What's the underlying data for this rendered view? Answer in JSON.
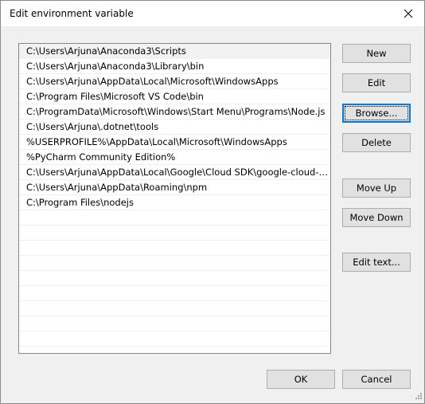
{
  "window": {
    "title": "Edit environment variable"
  },
  "paths": [
    "C:\\Users\\Arjuna\\Anaconda3\\Scripts",
    "C:\\Users\\Arjuna\\Anaconda3\\Library\\bin",
    "C:\\Users\\Arjuna\\AppData\\Local\\Microsoft\\WindowsApps",
    "C:\\Program Files\\Microsoft VS Code\\bin",
    "C:\\ProgramData\\Microsoft\\Windows\\Start Menu\\Programs\\Node.js",
    "C:\\Users\\Arjuna\\.dotnet\\tools",
    "%USERPROFILE%\\AppData\\Local\\Microsoft\\WindowsApps",
    "%PyCharm Community Edition%",
    "C:\\Users\\Arjuna\\AppData\\Local\\Google\\Cloud SDK\\google-cloud-sd...",
    "C:\\Users\\Arjuna\\AppData\\Roaming\\npm",
    "C:\\Program Files\\nodejs"
  ],
  "buttons": {
    "new": "New",
    "edit": "Edit",
    "browse": "Browse...",
    "delete": "Delete",
    "move_up": "Move Up",
    "move_down": "Move Down",
    "edit_text": "Edit text...",
    "ok": "OK",
    "cancel": "Cancel"
  },
  "colors": {
    "focus_accent": "#0078d7",
    "selected_row": "#f2f2f2"
  }
}
